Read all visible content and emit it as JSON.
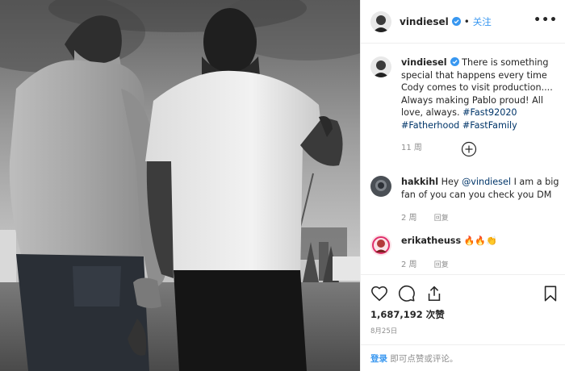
{
  "post": {
    "username": "vindiesel",
    "follow_label": "关注",
    "separator": "•",
    "more_label": "•••"
  },
  "caption": {
    "username": "vindiesel",
    "text": "There is something special that happens every time Cody comes to visit production.... Always making Pablo proud! All love, always.",
    "hashtags": [
      "#Fast92020",
      "#Fatherhood",
      "#FastFamily"
    ],
    "time": "11 周"
  },
  "comments": [
    {
      "username": "hakkihl",
      "mention": "@vindiesel",
      "text_before": "Hey",
      "text_after": "I am a big fan of you can you check you DM",
      "time": "2 周",
      "reply_label": "回复"
    },
    {
      "username": "erikatheuss",
      "text": "🔥🔥👏",
      "time": "2 周",
      "reply_label": "回复"
    }
  ],
  "actions": {
    "icons": [
      "heart-icon",
      "comment-icon",
      "share-icon",
      "bookmark-icon"
    ],
    "likes_count": "1,687,192",
    "likes_suffix": "次赞",
    "date": "8月25日"
  },
  "login": {
    "link": "登录",
    "prompt": "即可点赞或评论。"
  },
  "colors": {
    "link_blue": "#3897f0",
    "verified_blue": "#3897f0",
    "hashtag": "#003569",
    "muted": "#8e8e8e",
    "text": "#262626"
  }
}
